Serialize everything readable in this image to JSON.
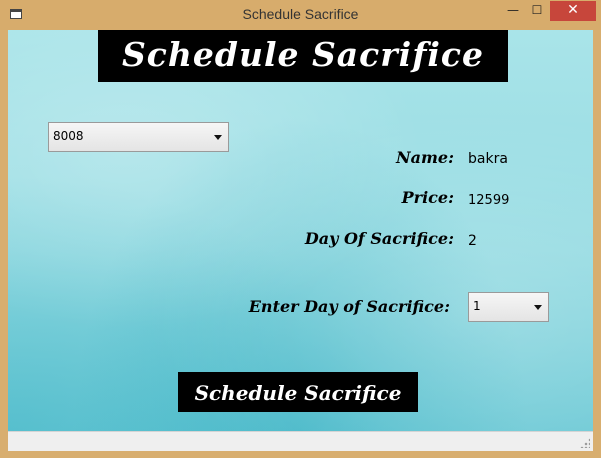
{
  "window": {
    "title": "Schedule Sacrifice",
    "minimize_glyph": "—",
    "maximize_glyph": "☐",
    "close_glyph": "✕"
  },
  "banner": {
    "text": "Schedule Sacrifice"
  },
  "animal_select": {
    "selected": "8008"
  },
  "details": {
    "name_label": "Name:",
    "name_value": "bakra",
    "price_label": "Price:",
    "price_value": "12599",
    "day_label": "Day Of Sacrifice:",
    "day_value": "2"
  },
  "enter_day": {
    "label": "Enter Day of Sacrifice:",
    "selected": "1"
  },
  "actions": {
    "schedule_label": "Schedule Sacrifice"
  },
  "colors": {
    "title_bar": "#d7ac6c",
    "close_button": "#c7463b",
    "background_teal": "#95dbe2",
    "banner_bg": "#000000",
    "banner_text": "#ffffff"
  },
  "icons": {
    "app_icon": "window-icon",
    "dropdown_arrow": "chevron-down-icon",
    "resize_grip": "resize-grip-icon"
  }
}
